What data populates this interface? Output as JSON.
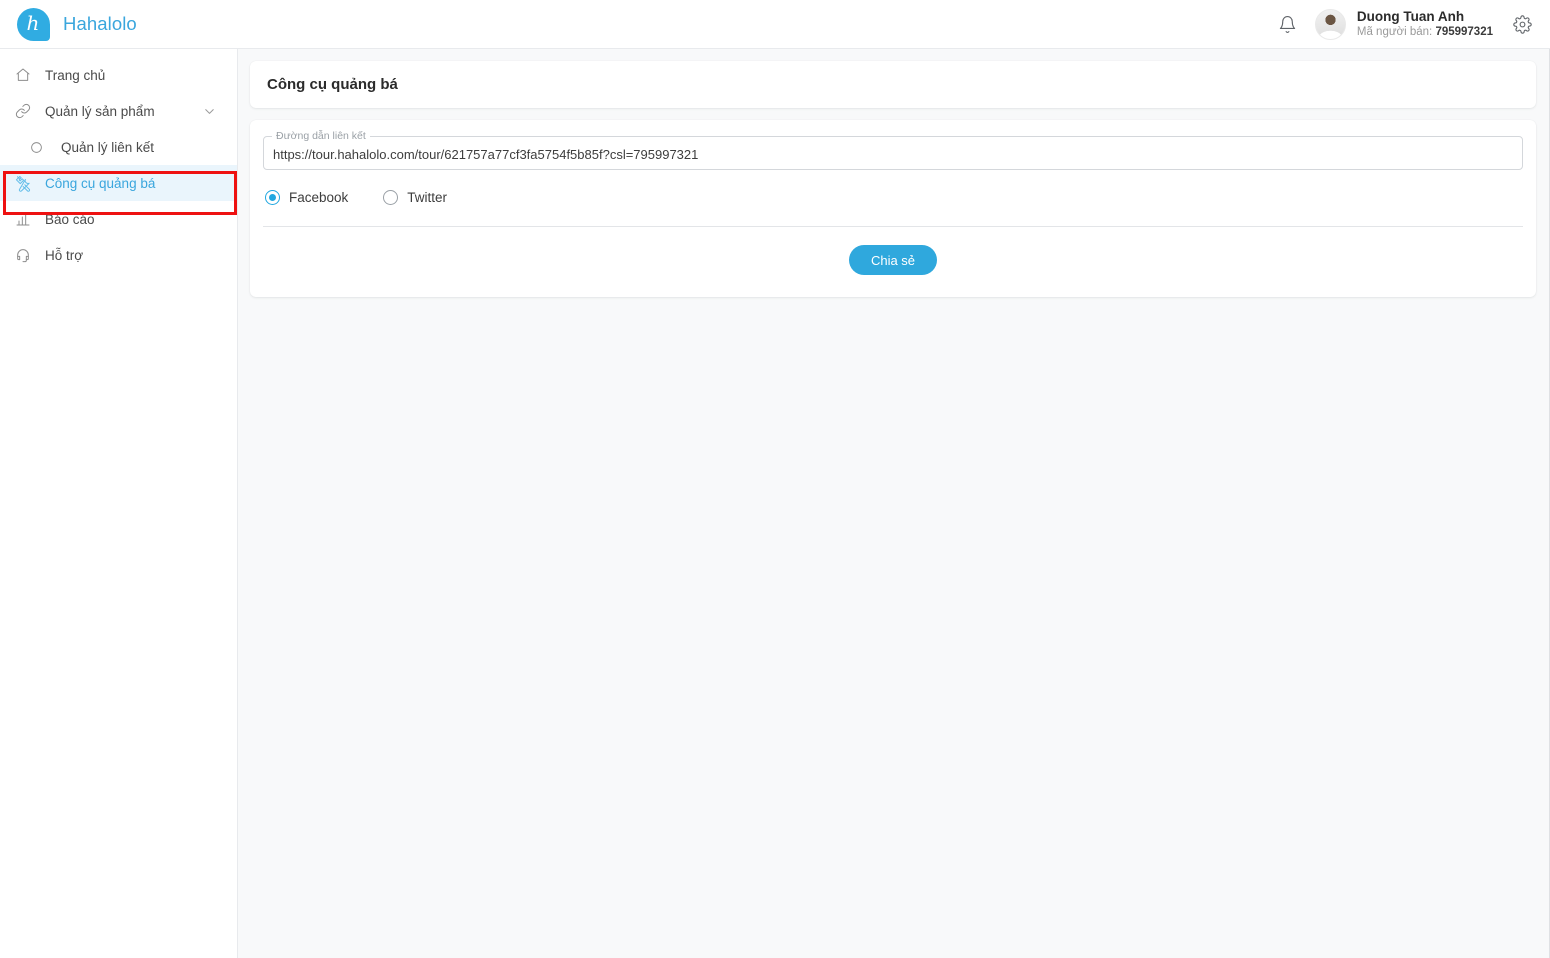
{
  "header": {
    "brand_name": "Hahalolo",
    "logo_letter": "h",
    "bell_icon": "notification-bell-icon",
    "gear_icon": "settings-gear-icon",
    "user_name": "Duong Tuan Anh",
    "user_id_label": "Mã người bán:",
    "user_id_value": "795997321"
  },
  "sidebar": {
    "items": [
      {
        "label": "Trang chủ",
        "icon": "home-icon",
        "active": false,
        "sub": false,
        "caret": false
      },
      {
        "label": "Quản lý sản phẩm",
        "icon": "link-chain-icon",
        "active": false,
        "sub": false,
        "caret": true
      },
      {
        "label": "Quản lý liên kết",
        "icon": "circle-bullet-icon",
        "active": false,
        "sub": true,
        "caret": false
      },
      {
        "label": "Công cụ quảng bá",
        "icon": "crossed-tools-icon",
        "active": true,
        "sub": false,
        "caret": false
      },
      {
        "label": "Báo cáo",
        "icon": "bar-chart-icon",
        "active": false,
        "sub": false,
        "caret": false
      },
      {
        "label": "Hỗ trợ",
        "icon": "headset-icon",
        "active": false,
        "sub": false,
        "caret": false
      }
    ]
  },
  "main": {
    "page_title": "Công cụ quảng bá",
    "link_field": {
      "legend": "Đường dẫn liên kết",
      "value": "https://tour.hahalolo.com/tour/621757a77cf3fa5754f5b85f?csl=795997321",
      "placeholder": "Đường dẫn liên kết"
    },
    "share_targets": [
      {
        "label": "Facebook",
        "checked": true
      },
      {
        "label": "Twitter",
        "checked": false
      }
    ],
    "share_button_label": "Chia sẻ"
  },
  "colors": {
    "brand": "#3aa6dd",
    "accent": "#2fa8dd",
    "active_bg": "#eaf5fc",
    "highlight_box": "#ee1111",
    "page_bg": "#f8f9fa"
  }
}
